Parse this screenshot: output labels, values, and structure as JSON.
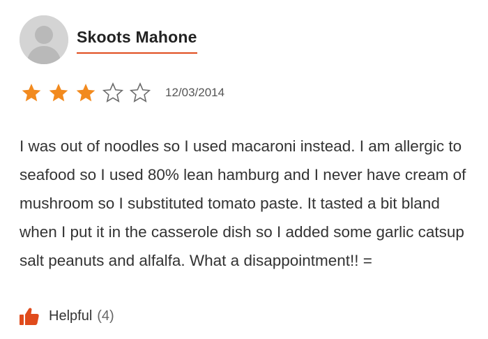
{
  "author": {
    "name": "Skoots Mahone"
  },
  "rating": {
    "value": 3,
    "max": 5,
    "date": "12/03/2014"
  },
  "review": {
    "text": "I was out of noodles so I used macaroni instead. I am allergic to seafood so I used 80% lean hamburg and I never have cream of mushroom so I substituted tomato paste. It tasted a bit bland when I put it in the casserole dish so I added some garlic catsup salt peanuts and alfalfa. What a disappointment!! ="
  },
  "helpful": {
    "label": "Helpful",
    "count": "(4)"
  },
  "colors": {
    "accent": "#e04b1c",
    "star_filled": "#f28a1e",
    "star_empty": "#6b6b6b",
    "avatar_bg": "#d4d4d4"
  },
  "icons": {
    "avatar": "default-user-avatar",
    "star_filled": "star-filled-icon",
    "star_empty": "star-outline-icon",
    "helpful": "thumbs-up-icon"
  }
}
